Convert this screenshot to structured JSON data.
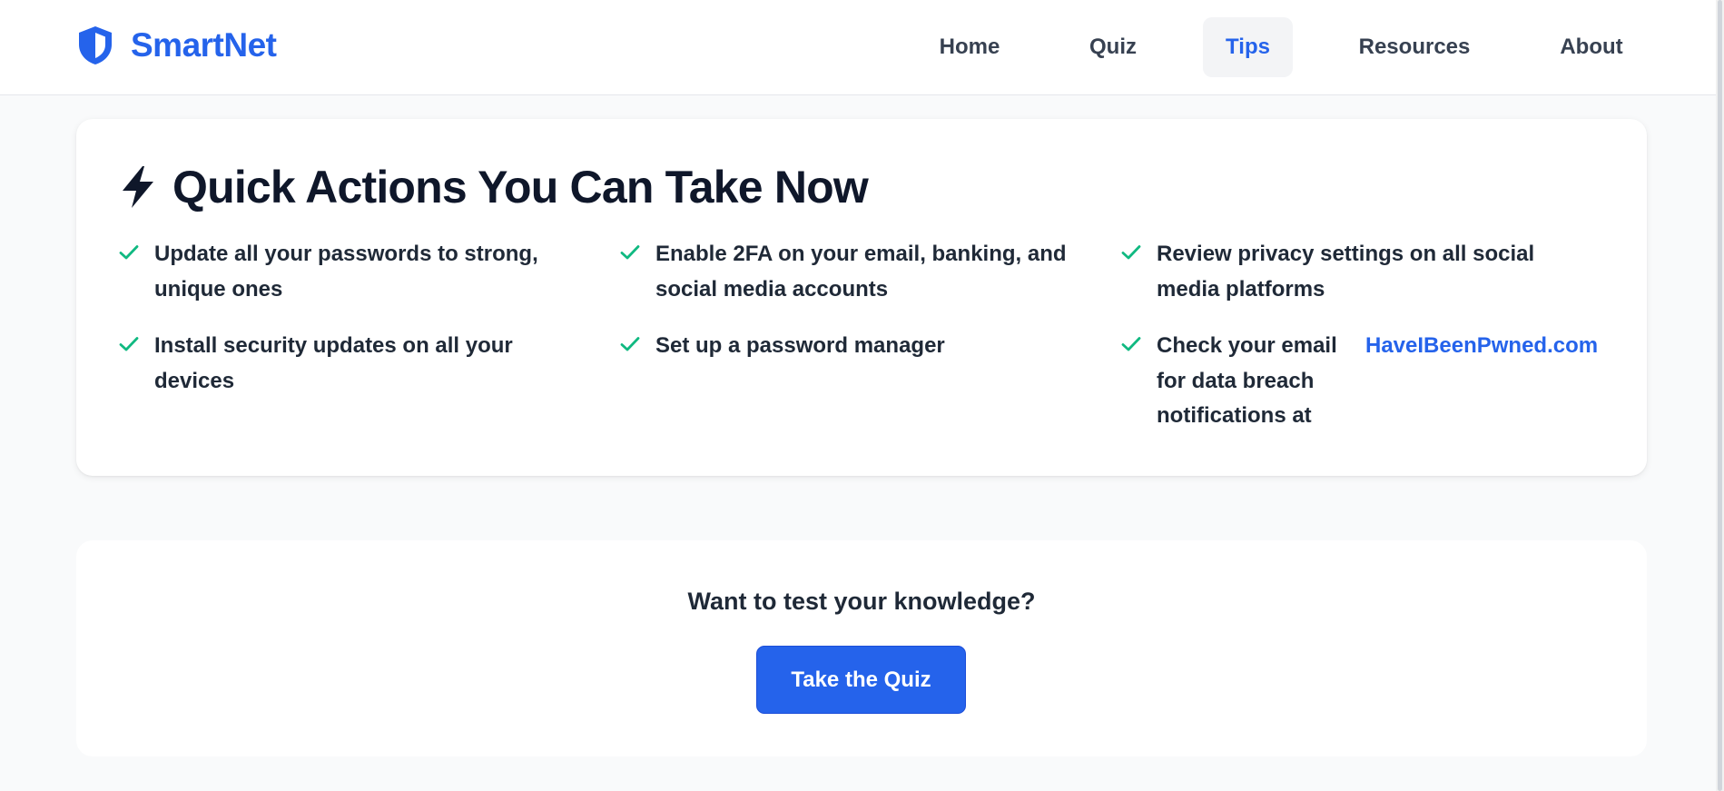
{
  "header": {
    "brand": {
      "name": "SmartNet",
      "icon": "shield-icon",
      "color": "#2563eb"
    },
    "nav": {
      "items": [
        {
          "label": "Home",
          "active": false
        },
        {
          "label": "Quiz",
          "active": false
        },
        {
          "label": "Tips",
          "active": true
        },
        {
          "label": "Resources",
          "active": false
        },
        {
          "label": "About",
          "active": false
        }
      ]
    }
  },
  "quick_actions": {
    "icon": "lightning-bolt-icon",
    "title": "Quick Actions You Can Take Now",
    "check_icon": "check-icon",
    "check_color": "#10b981",
    "items": [
      {
        "text": "Update all your passwords to strong, unique ones"
      },
      {
        "text": "Enable 2FA on your email, banking, and social media accounts"
      },
      {
        "text": "Review privacy settings on all social media platforms"
      },
      {
        "text": "Install security updates on all your devices"
      },
      {
        "text": "Set up a password manager"
      },
      {
        "text": "Check your email for data breach notifications at",
        "link": "HaveIBeenPwned.com"
      }
    ]
  },
  "cta": {
    "question": "Want to test your knowledge?",
    "button_label": "Take the Quiz"
  },
  "colors": {
    "accent": "#2563eb",
    "success": "#10b981",
    "page_background": "#f9fafb",
    "heading": "#0f172a"
  }
}
